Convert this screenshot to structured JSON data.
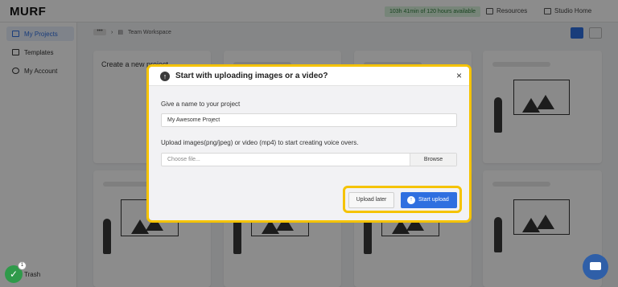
{
  "app": {
    "logo": "MURF",
    "credits": "103h 41min of 120 hours available",
    "nav_resources": "Resources",
    "nav_studio_home": "Studio Home"
  },
  "sidebar": {
    "items": [
      {
        "label": "My Projects",
        "active": true
      },
      {
        "label": "Templates"
      },
      {
        "label": "My Account"
      }
    ],
    "trash": "Trash",
    "notification_count": "1"
  },
  "breadcrumb": {
    "dots": "•••",
    "workspace": "Team Workspace"
  },
  "cards": {
    "create_new": "Create a new project"
  },
  "modal": {
    "title": "Start with uploading images or a video?",
    "close": "×",
    "name_label": "Give a name to your project",
    "name_value": "My Awesome Project",
    "upload_label": "Upload images(png/jpeg) or video (mp4) to start creating voice overs.",
    "file_placeholder": "Choose file...",
    "browse": "Browse",
    "upload_later": "Upload later",
    "start_upload": "Start upload"
  },
  "colors": {
    "accent": "#2f6fe0",
    "highlight": "#f5c300",
    "credits_bg": "#d9f2dc"
  }
}
